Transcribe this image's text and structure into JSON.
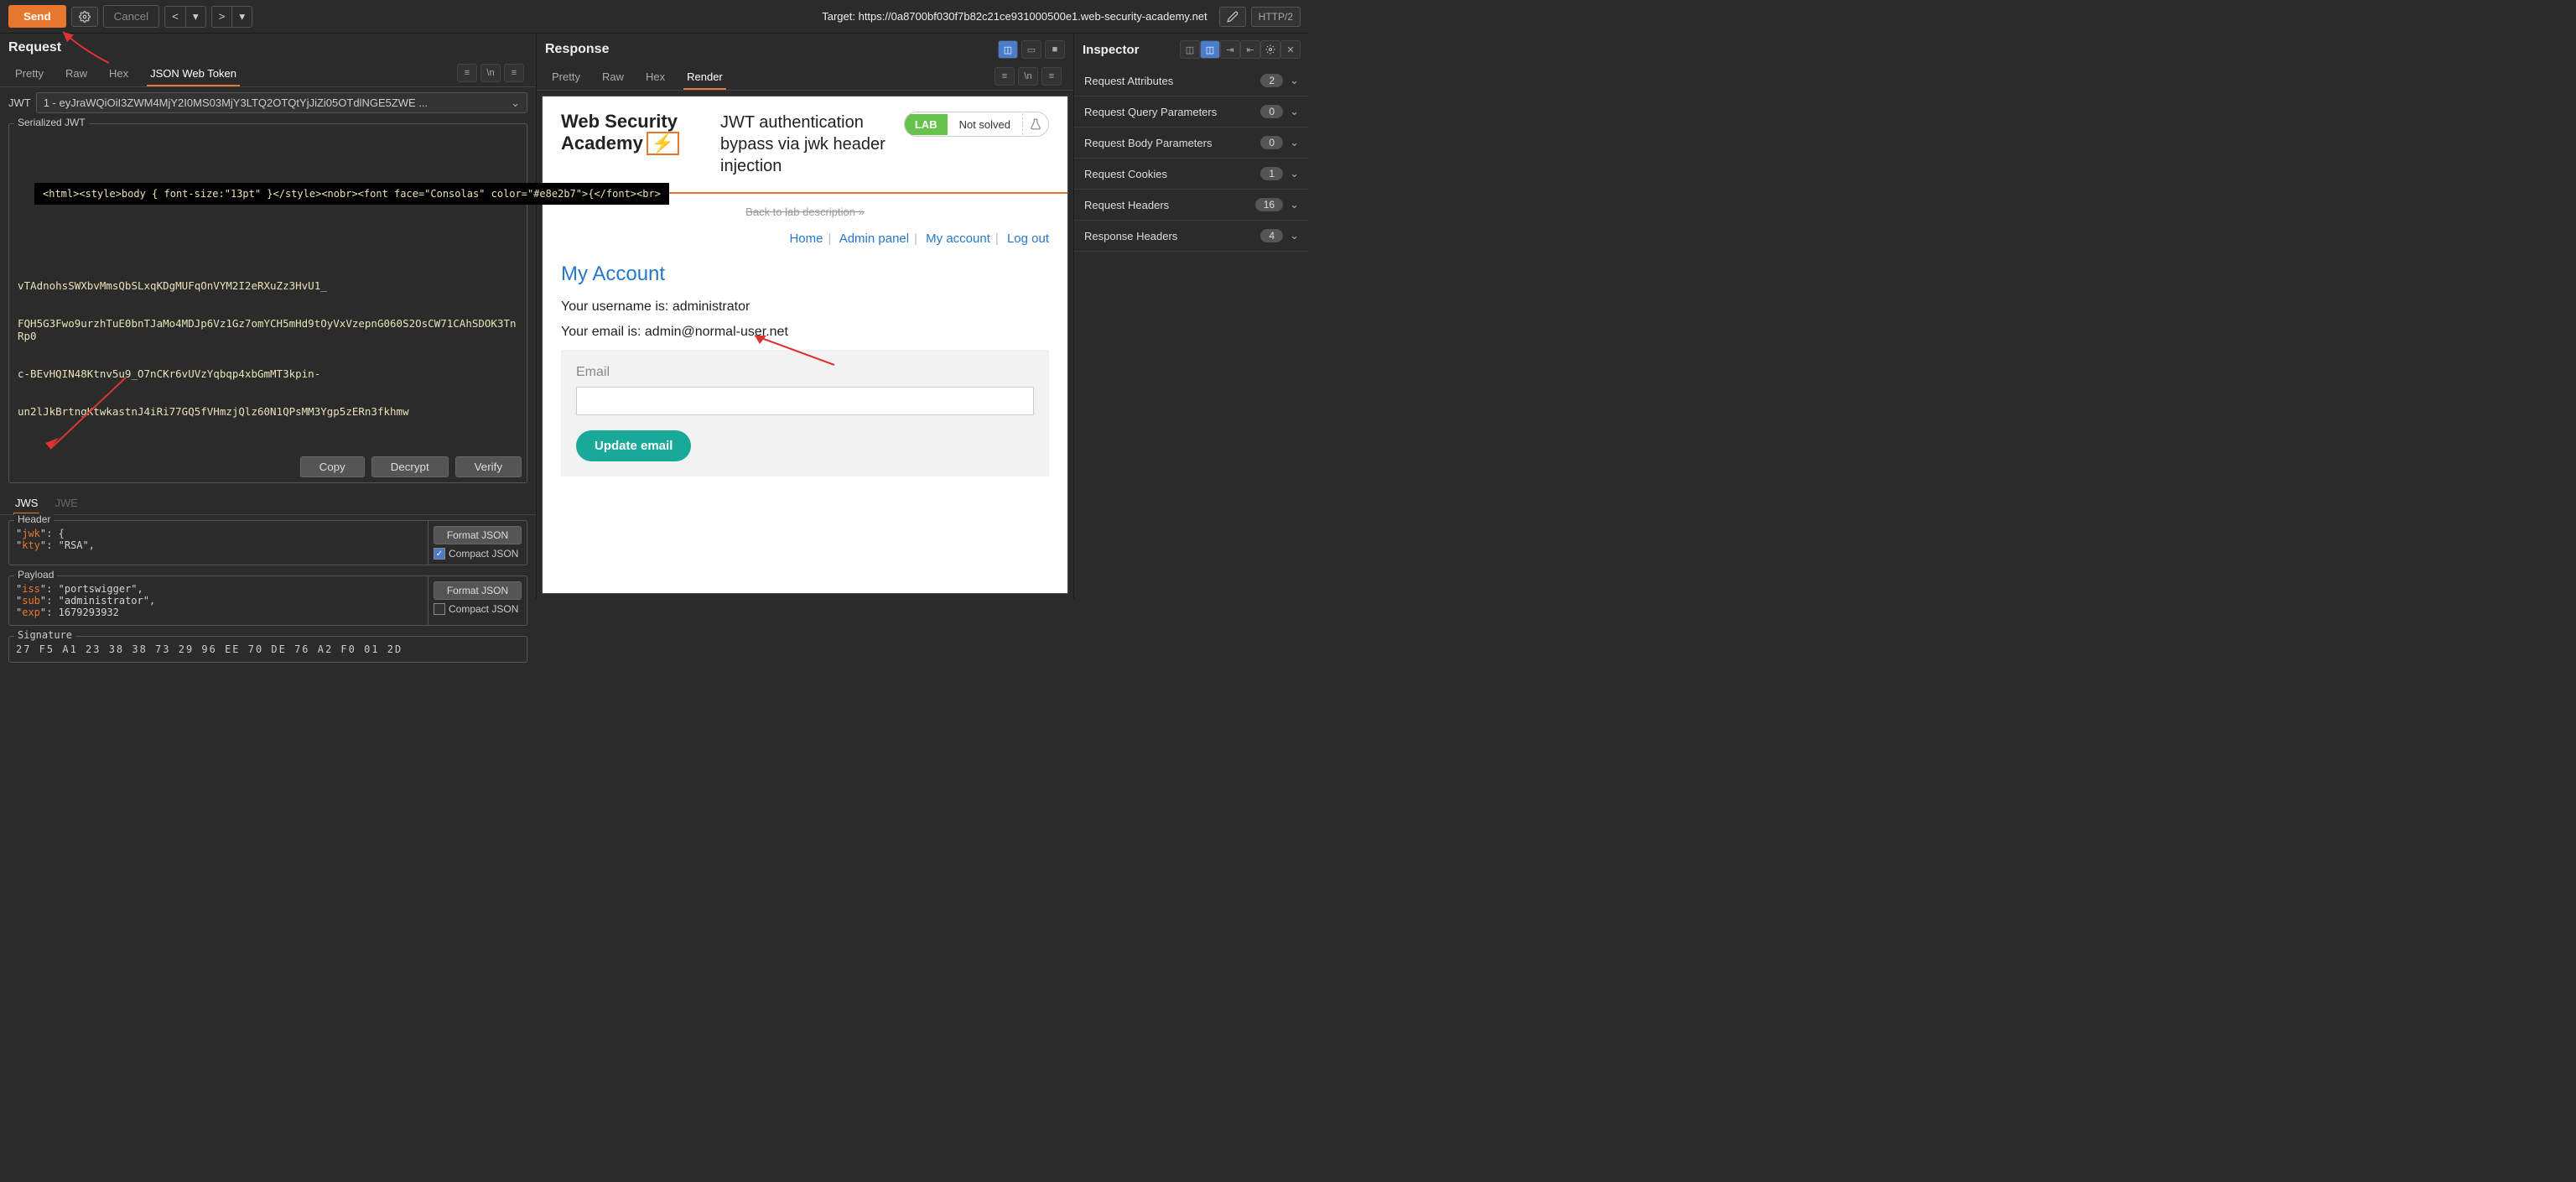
{
  "toolbar": {
    "send": "Send",
    "cancel": "Cancel",
    "target_prefix": "Target: ",
    "target_url": "https://0a8700bf030f7b82c21ce931000500e1.web-security-academy.net",
    "http_version": "HTTP/2"
  },
  "request": {
    "title": "Request",
    "tabs": [
      "Pretty",
      "Raw",
      "Hex",
      "JSON Web Token"
    ],
    "active_tab": 3,
    "jwt_label": "JWT",
    "jwt_selected": "1 - eyJraWQiOiI3ZWM4MjY2I0MS03MjY3LTQ2OTQtYjJiZi05OTdlNGE5ZWE ...",
    "serialized_legend": "Serialized JWT",
    "serialized_body_lines": [
      "vTAdnohsSWXbvMmsQbSLxqKDgMUFqOnVYM2I2eRXuZz3HvU1_",
      "FQH5G3Fwo9urzhTuE0bnTJaMo4MDJp6Vz1Gz7omYCH5mHd9tOyVxVzepnG060S2OsCW71CAhSDOK3TnRp0",
      "c-BEvHQIN48Ktnv5u9_O7nCKr6vUVzYqbqp4xbGmMT3kpin-",
      "un2lJkBrtngKtwkastnJ4iRi77GQ5fVHmzjQlz60N1QPsMM3Ygp5zERn3fkhmw"
    ],
    "tooltip": "<html><style>body { font-size:\"13pt\" }</style><nobr><font face=\"Consolas\" color=\"#e8e2b7\">{</font><br>",
    "buttons": {
      "copy": "Copy",
      "decrypt": "Decrypt",
      "verify": "Verify"
    },
    "subtabs": [
      "JWS",
      "JWE"
    ],
    "active_subtab": 0,
    "header_legend": "Header",
    "header_code": "  \"jwk\": {\n      \"kty\": \"RSA\",",
    "payload_legend": "Payload",
    "payload_code": "  \"iss\": \"portswigger\",\n  \"sub\": \"administrator\",\n  \"exp\": 1679293932",
    "format_json": "Format JSON",
    "compact_json": "Compact JSON",
    "signature_legend": "Signature",
    "signature_hex": "27  F5  A1  23  38  38  73  29  96  EE  70  DE  76  A2  F0  01  2D"
  },
  "response": {
    "title": "Response",
    "tabs": [
      "Pretty",
      "Raw",
      "Hex",
      "Render"
    ],
    "active_tab": 3,
    "render": {
      "wsa_line1": "Web Security",
      "wsa_line2": "Academy",
      "lab_title": "JWT authentication bypass via jwk header injection",
      "lab_badge": "LAB",
      "lab_state": "Not solved",
      "back_link": "Back to lab description  »",
      "nav": [
        "Home",
        "Admin panel",
        "My account",
        "Log out"
      ],
      "acct_title": "My Account",
      "username_line": "Your username is: administrator",
      "email_line": "Your email is: admin@normal-user.net",
      "email_label": "Email",
      "update_btn": "Update email"
    }
  },
  "inspector": {
    "title": "Inspector",
    "items": [
      {
        "label": "Request Attributes",
        "count": "2"
      },
      {
        "label": "Request Query Parameters",
        "count": "0"
      },
      {
        "label": "Request Body Parameters",
        "count": "0"
      },
      {
        "label": "Request Cookies",
        "count": "1"
      },
      {
        "label": "Request Headers",
        "count": "16"
      },
      {
        "label": "Response Headers",
        "count": "4"
      }
    ]
  }
}
